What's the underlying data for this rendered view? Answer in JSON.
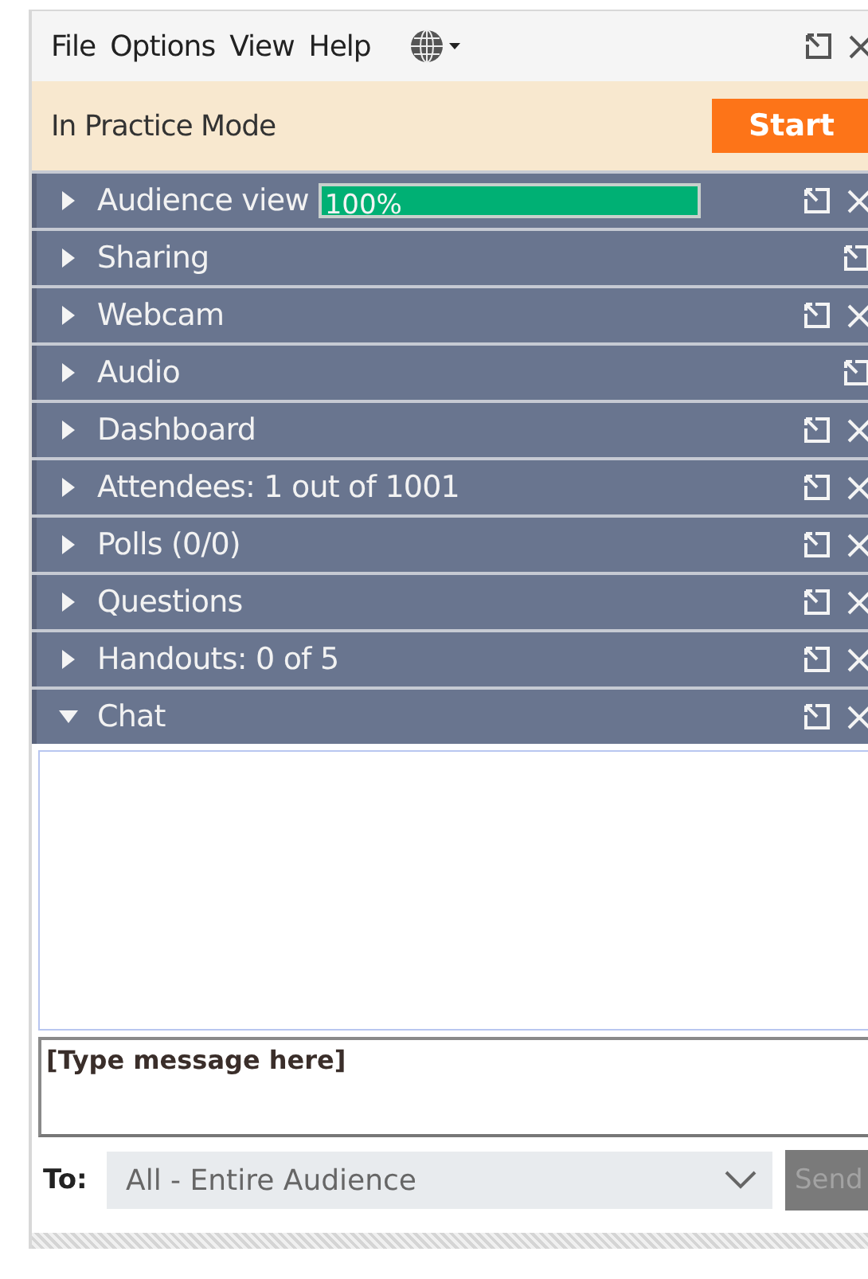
{
  "menu": [
    {
      "label": "File"
    },
    {
      "label": "Options"
    },
    {
      "label": "View"
    },
    {
      "label": "Help"
    }
  ],
  "mode_bar": {
    "text": "In Practice Mode",
    "button": "Start"
  },
  "panels": [
    {
      "title": "Audience view",
      "expanded": false,
      "closable": true,
      "level": 1,
      "reading": "100%"
    },
    {
      "title": "Sharing",
      "expanded": false,
      "closable": false
    },
    {
      "title": "Webcam",
      "expanded": false,
      "closable": true
    },
    {
      "title": "Audio",
      "expanded": false,
      "closable": false
    },
    {
      "title": "Dashboard",
      "expanded": false,
      "closable": true
    },
    {
      "title": "Attendees: 1 out of 1001",
      "expanded": false,
      "closable": true
    },
    {
      "title": "Polls (0/0)",
      "expanded": false,
      "closable": true
    },
    {
      "title": "Questions",
      "expanded": false,
      "closable": true
    },
    {
      "title": "Handouts: 0 of 5",
      "expanded": false,
      "closable": true
    },
    {
      "title": "Chat",
      "expanded": true,
      "closable": true
    }
  ],
  "chat": {
    "placeholder": "[Type message here]",
    "to_label": "To:",
    "recipient": "All - Entire Audience",
    "send": "Send",
    "send_disabled": true
  }
}
